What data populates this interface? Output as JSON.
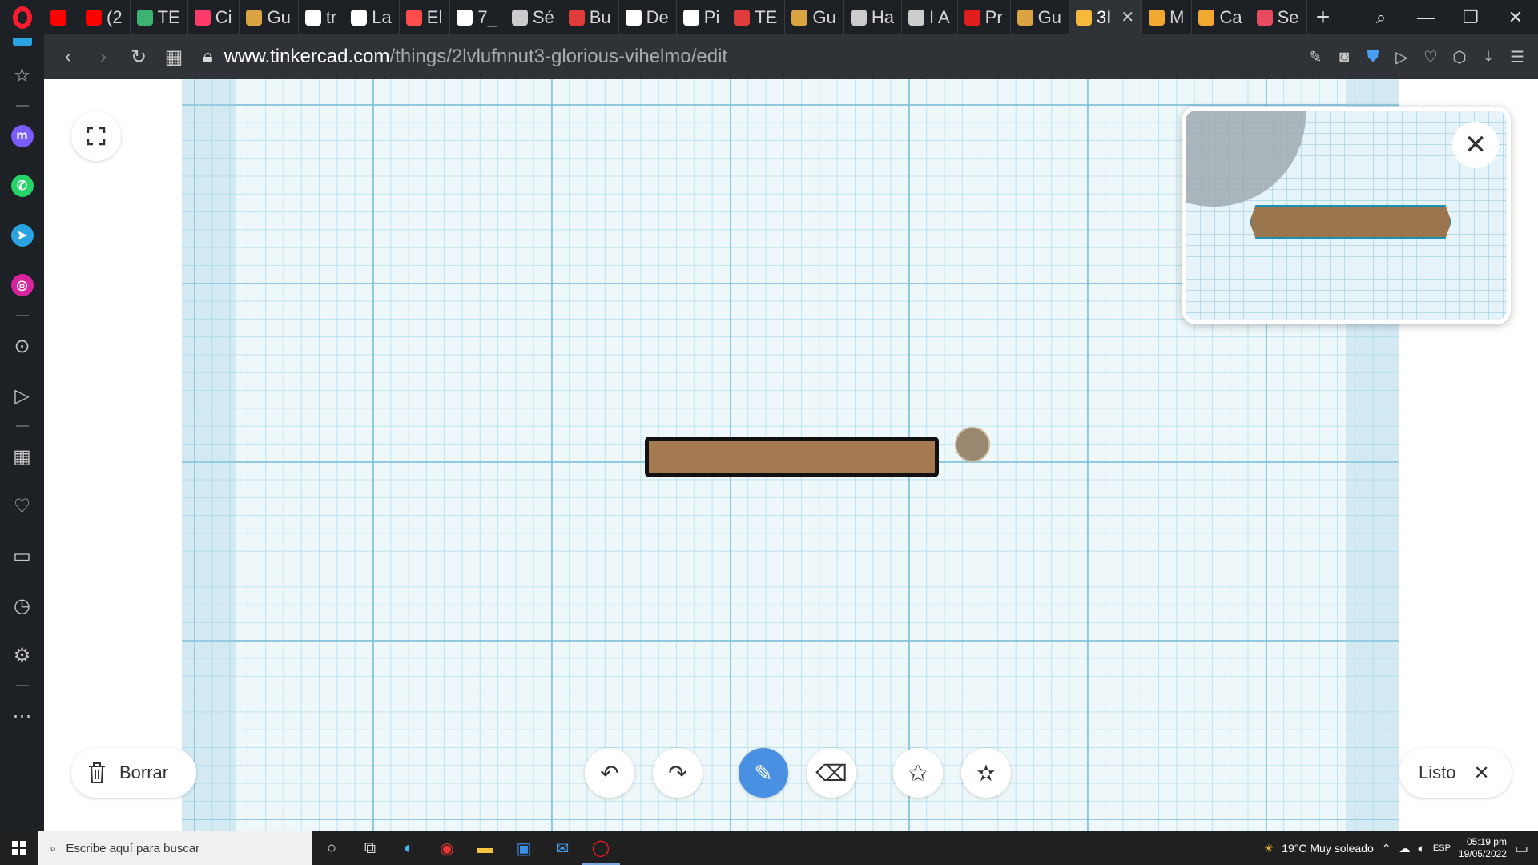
{
  "tabs": [
    {
      "label": "",
      "favicon_color": "#ff0000"
    },
    {
      "label": "(2",
      "favicon_color": "#ff0000"
    },
    {
      "label": "TE",
      "favicon_color": "#3cb371"
    },
    {
      "label": "Ci",
      "favicon_color": "#ff3b6b"
    },
    {
      "label": "Gu",
      "favicon_color": "#d9a441"
    },
    {
      "label": "tr",
      "favicon_color": "#ffffff"
    },
    {
      "label": "La",
      "favicon_color": "#ffffff"
    },
    {
      "label": "El",
      "favicon_color": "#ff4d4d"
    },
    {
      "label": "7_",
      "favicon_color": "#ffffff"
    },
    {
      "label": "Sé",
      "favicon_color": "#cccccc"
    },
    {
      "label": "Bu",
      "favicon_color": "#e03c3c"
    },
    {
      "label": "De",
      "favicon_color": "#ffffff"
    },
    {
      "label": "Pi",
      "favicon_color": "#ffffff"
    },
    {
      "label": "TE",
      "favicon_color": "#e03c3c"
    },
    {
      "label": "Gu",
      "favicon_color": "#d9a441"
    },
    {
      "label": "Ha",
      "favicon_color": "#cccccc"
    },
    {
      "label": "I A",
      "favicon_color": "#cccccc"
    },
    {
      "label": "Pr",
      "favicon_color": "#e01e1e"
    },
    {
      "label": "Gu",
      "favicon_color": "#d9a441"
    },
    {
      "label": "3I",
      "favicon_color": "#f6b93b",
      "active": true
    },
    {
      "label": "M",
      "favicon_color": "#f0a830"
    },
    {
      "label": "Ca",
      "favicon_color": "#f0a830"
    },
    {
      "label": "Se",
      "favicon_color": "#e84a5f"
    }
  ],
  "address": {
    "host": "www.tinkercad.com",
    "path": "/things/2lvlufnnut3-glorious-vihelmo/edit"
  },
  "sidebar": {
    "items": [
      {
        "name": "messenger",
        "color": "#7b5cff",
        "glyph": "m"
      },
      {
        "name": "whatsapp",
        "color": "#25d366",
        "glyph": "✆"
      },
      {
        "name": "telegram",
        "color": "#2aa3e0",
        "glyph": "➤"
      },
      {
        "name": "instagram",
        "color": "#d6249f",
        "glyph": "◎"
      }
    ]
  },
  "editor": {
    "delete_label": "Borrar",
    "done_label": "Listo",
    "shape_color": "#a57a52",
    "active_tool_color": "#4a90e2"
  },
  "taskbar": {
    "search_placeholder": "Escribe aquí para buscar",
    "weather": "19°C  Muy soleado",
    "language": "ESP",
    "time": "05:19 pm",
    "date": "19/05/2022"
  }
}
